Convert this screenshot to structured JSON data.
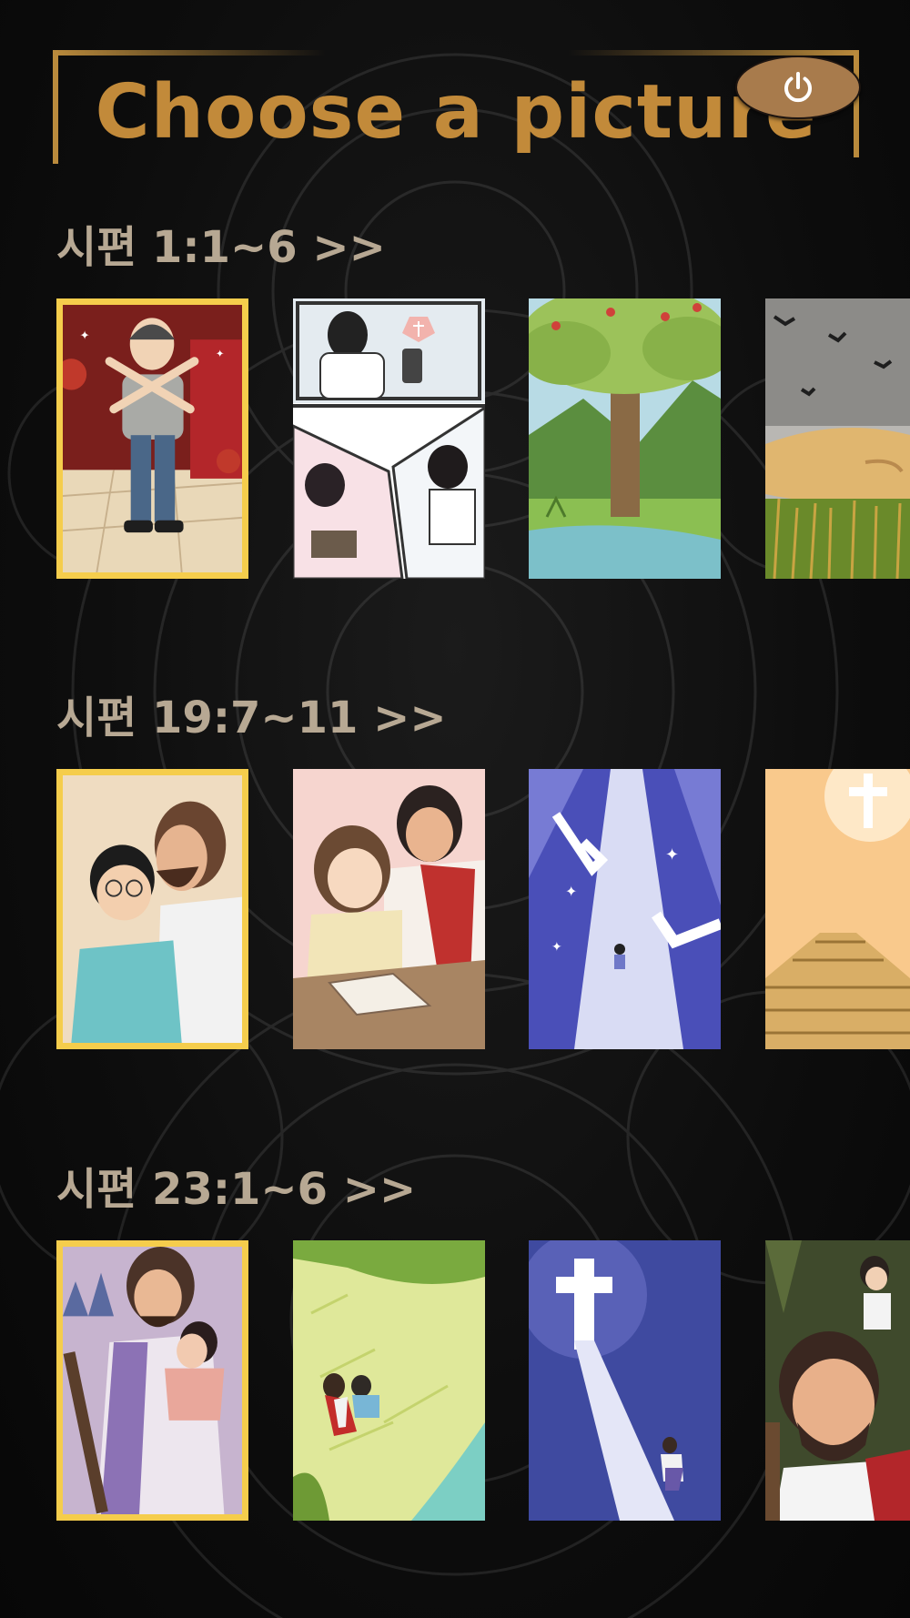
{
  "header": {
    "title": "Choose a picture",
    "power_icon": "power-icon"
  },
  "colors": {
    "title_gold": "#c28a3a",
    "selection_border": "#f5cd4c",
    "power_button": "#a87b4c",
    "section_label": "#b7a893",
    "background": "#0d0d0d"
  },
  "sections": [
    {
      "label": "시편 1:1~6 >>",
      "pictures": [
        {
          "name": "boy-refusing-temptation",
          "selected": true
        },
        {
          "name": "girls-reading-bible",
          "selected": false
        },
        {
          "name": "fruit-tree-by-stream",
          "selected": false
        },
        {
          "name": "hand-over-grain-field",
          "selected": false
        }
      ]
    },
    {
      "label": "시편 19:7~11 >>",
      "pictures": [
        {
          "name": "jesus-whispering-to-boy",
          "selected": true
        },
        {
          "name": "jesus-with-girl-reading",
          "selected": false
        },
        {
          "name": "bible-signpost-path",
          "selected": false
        },
        {
          "name": "cross-over-gold-bars",
          "selected": false
        }
      ]
    },
    {
      "label": "시편 23:1~6 >>",
      "pictures": [
        {
          "name": "jesus-carrying-child",
          "selected": true
        },
        {
          "name": "resting-in-green-pasture",
          "selected": false
        },
        {
          "name": "light-of-the-cross",
          "selected": false
        },
        {
          "name": "shepherd-in-forest",
          "selected": false
        }
      ]
    }
  ]
}
